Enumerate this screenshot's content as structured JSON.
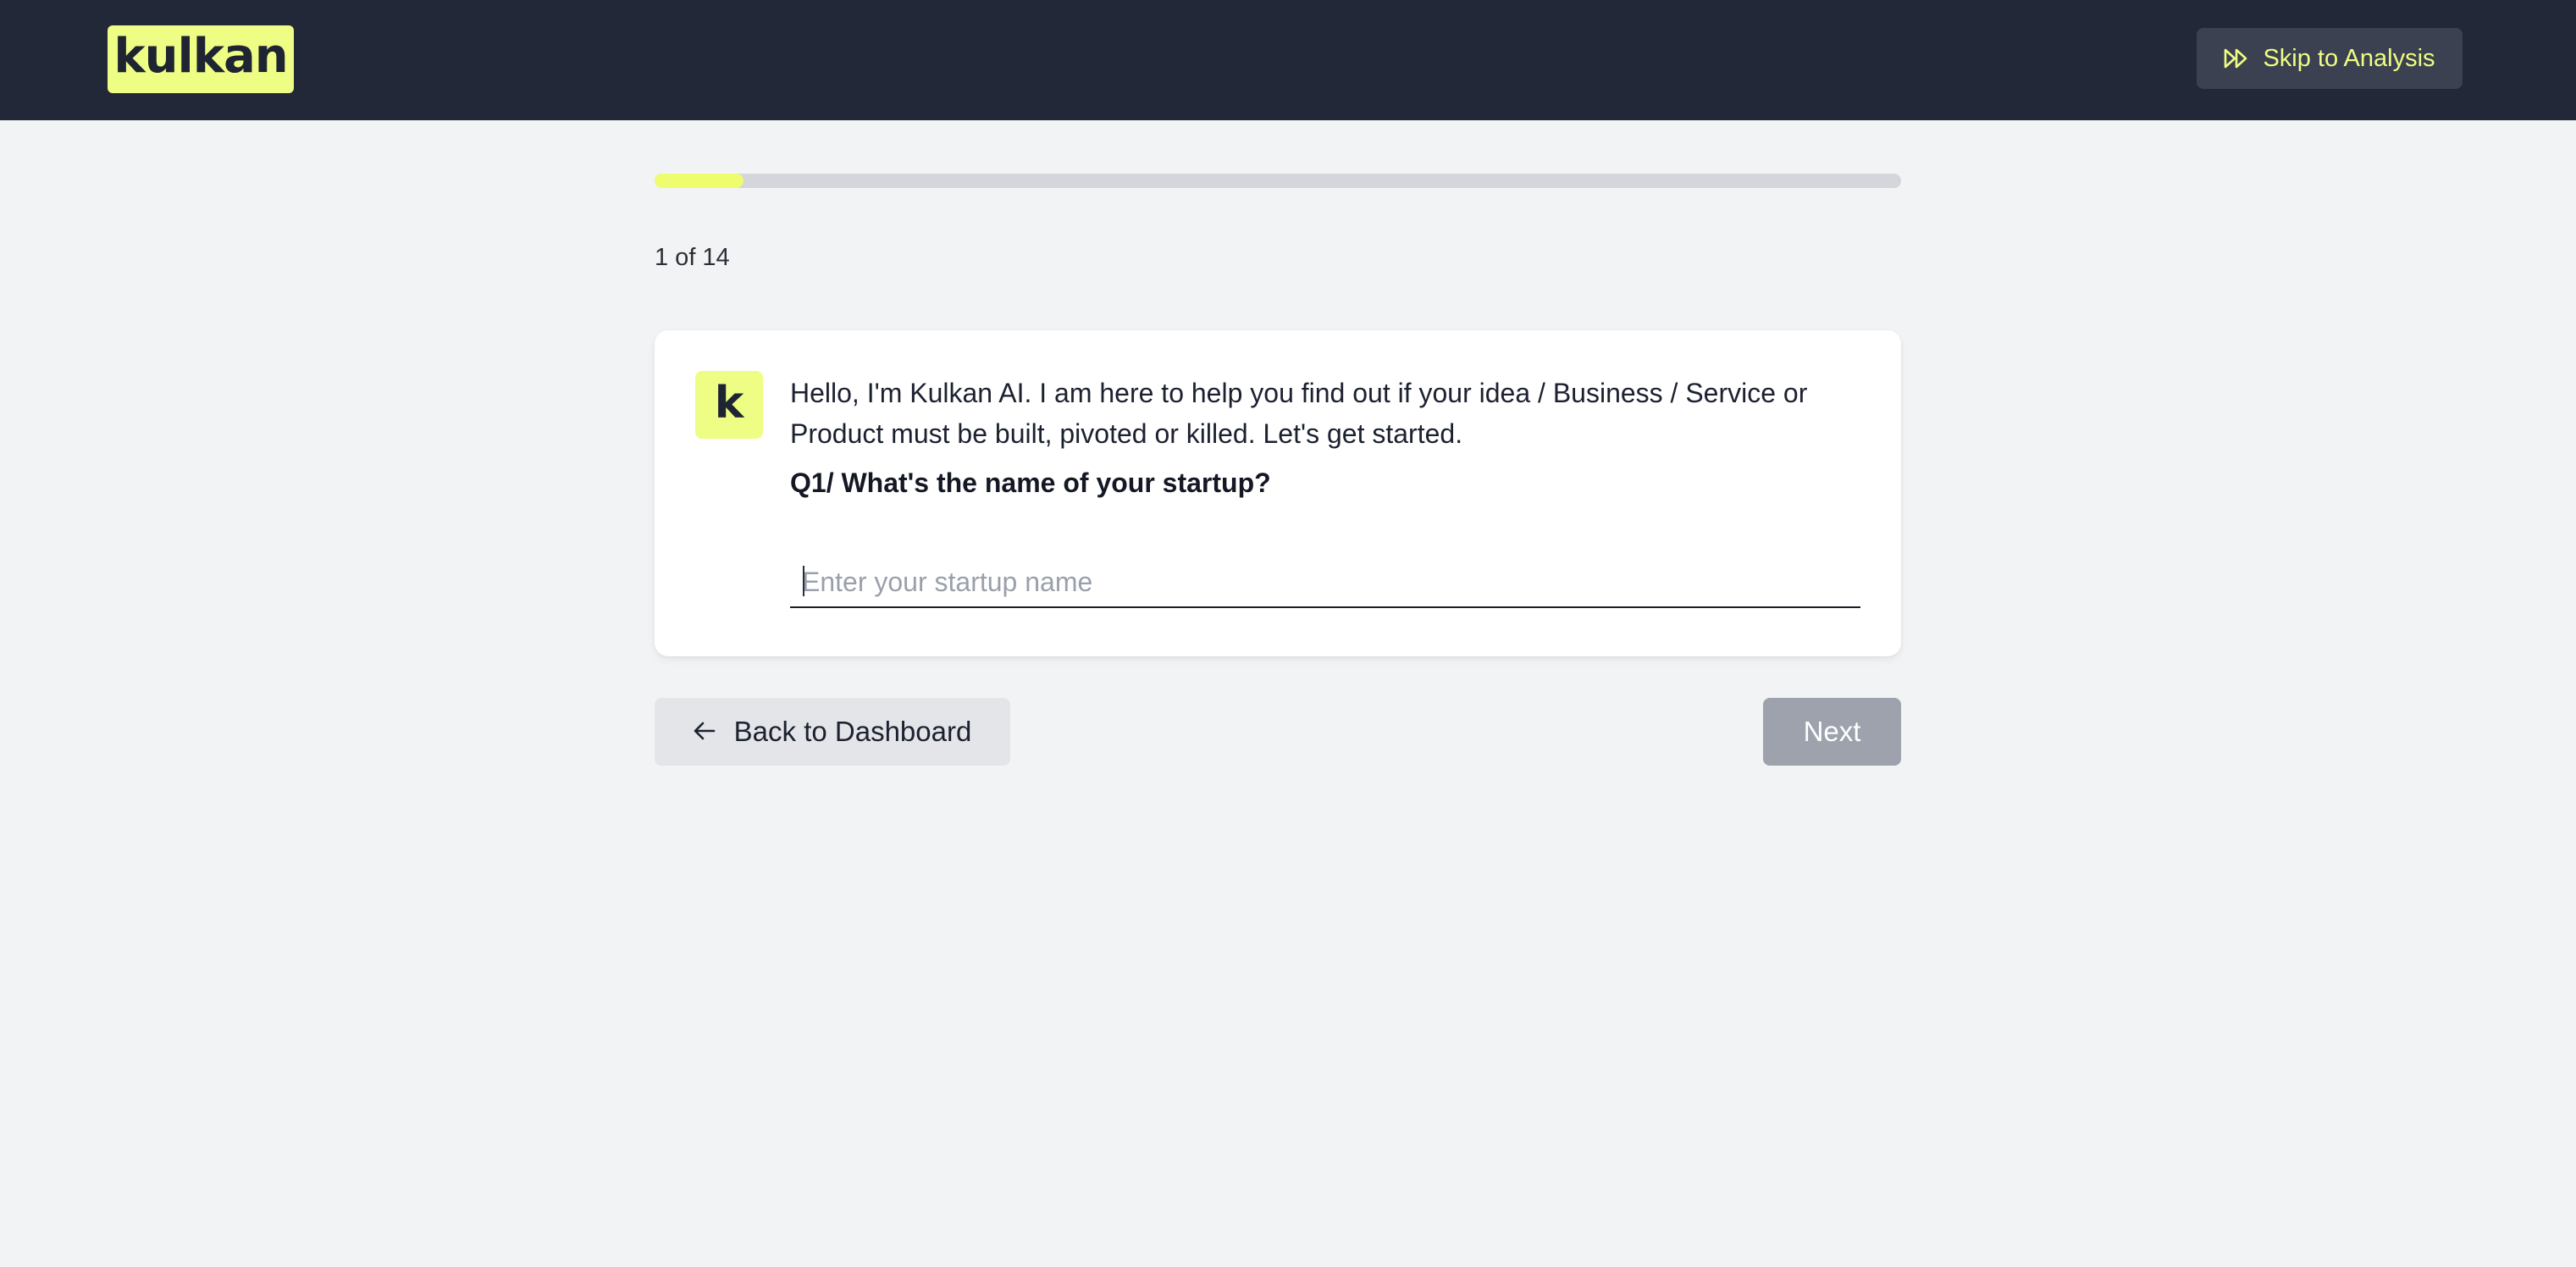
{
  "header": {
    "logo_text": "kulkan",
    "skip_label": "Skip to Analysis",
    "skip_icon": "fast-forward-icon"
  },
  "progress": {
    "current": 1,
    "total": 14,
    "fraction": 0.0714,
    "label": "1 of 14"
  },
  "card": {
    "avatar_letter": "k",
    "intro_text": "Hello, I'm Kulkan AI. I am here to help you find out if your idea / Business / Service or Product must be built, pivoted or killed. Let's get started.",
    "question": "Q1/ What's the name of your startup?",
    "input_value": "",
    "input_placeholder": "Enter your startup name"
  },
  "footer": {
    "back_label": "Back to Dashboard",
    "back_icon": "arrow-left-icon",
    "next_label": "Next"
  },
  "colors": {
    "header_bg": "#222838",
    "accent": "#eefd83",
    "page_bg": "#f2f3f5",
    "next_disabled": "#9da2ad"
  }
}
